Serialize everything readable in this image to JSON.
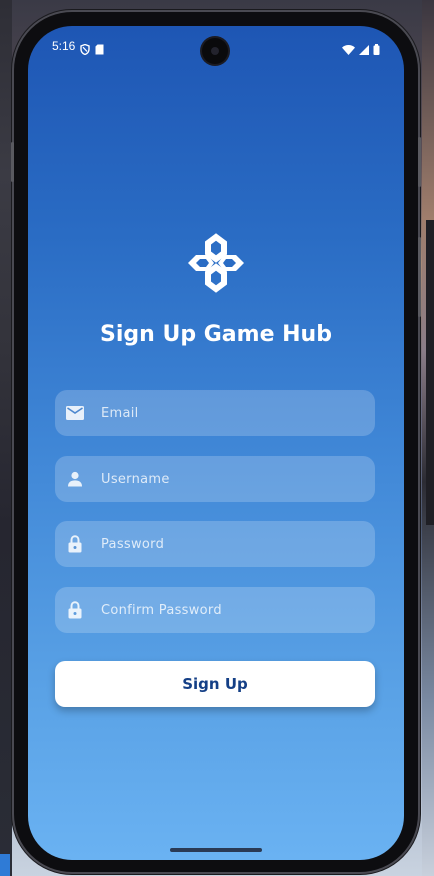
{
  "status_bar": {
    "time": "5:16",
    "left_icons": [
      "shield-icon",
      "sim-card-icon"
    ],
    "right_icons": [
      "wifi-icon",
      "cellular-signal-icon",
      "battery-icon"
    ]
  },
  "app": {
    "logo_icon": "gamepad-icon",
    "title": "Sign Up Game Hub"
  },
  "form": {
    "email": {
      "placeholder": "Email",
      "value": "",
      "icon": "mail-icon"
    },
    "username": {
      "placeholder": "Username",
      "value": "",
      "icon": "person-icon"
    },
    "password": {
      "placeholder": "Password",
      "value": "",
      "icon": "lock-icon"
    },
    "confirm_password": {
      "placeholder": "Confirm Password",
      "value": "",
      "icon": "lock-icon"
    },
    "submit_label": "Sign Up"
  },
  "colors": {
    "gradient_top": "#1e56b4",
    "gradient_bottom": "#6ab2f2",
    "button_text": "#143f86",
    "button_bg": "#ffffff"
  }
}
